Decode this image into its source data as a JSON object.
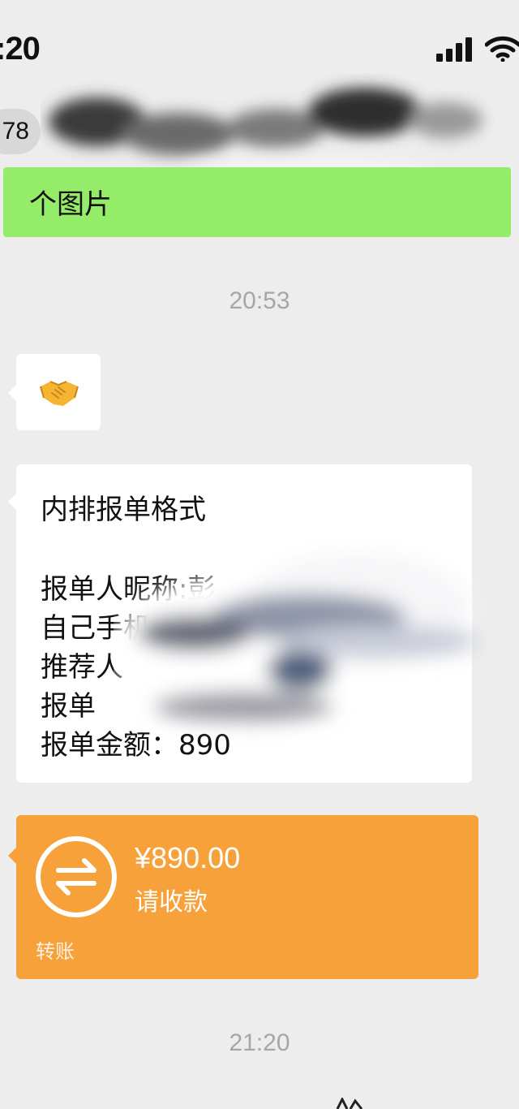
{
  "status_bar": {
    "time": ":20",
    "signal_icon": "cellular-signal-icon",
    "wifi_icon": "wifi-icon"
  },
  "header": {
    "unread_count": "78"
  },
  "messages": {
    "sent_text": "个图片",
    "time_1": "20:53",
    "emoji_icon": "handshake-icon",
    "form": {
      "line_1": "内排报单格式",
      "line_2": "报单人昵称:彭",
      "line_3": "自己手机",
      "line_4": "推荐人",
      "line_5": "报单",
      "line_6": "报单金额：890"
    },
    "transfer": {
      "icon": "transfer-arrows-icon",
      "amount": "¥890.00",
      "status": "请收款",
      "footer": "转账"
    },
    "time_2": "21:20"
  },
  "colors": {
    "background": "#ededed",
    "sent_bubble": "#95ec69",
    "transfer_card": "#f7a13a"
  }
}
